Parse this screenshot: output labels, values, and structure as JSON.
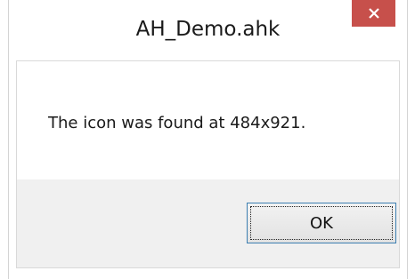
{
  "window": {
    "title": "AH_Demo.ahk",
    "close_symbol": "×",
    "close_icon": "close-icon",
    "accent_close_color": "#c7504b"
  },
  "dialog": {
    "message": "The icon was found at 484x921.",
    "ok_label": "OK"
  }
}
